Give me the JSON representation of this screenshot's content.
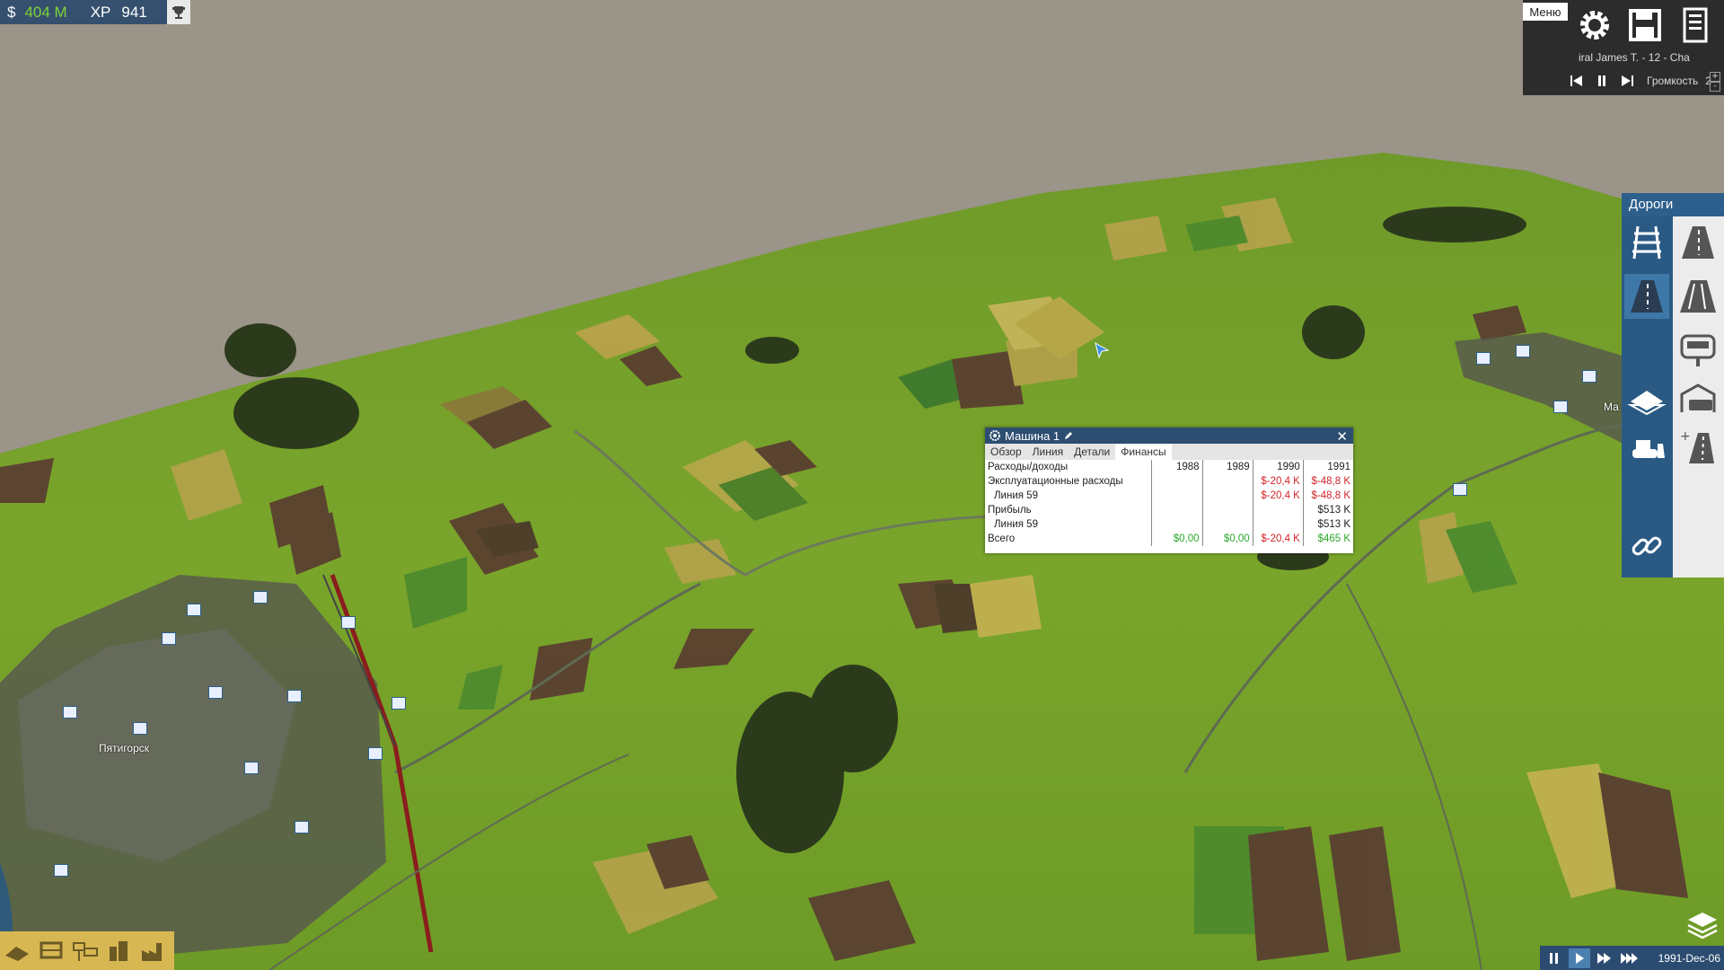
{
  "stats": {
    "currency_symbol": "$",
    "money": "404 M",
    "xp_label": "XP",
    "xp_value": "941",
    "trophy_icon": "trophy-icon"
  },
  "top_right": {
    "menu_label": "Меню",
    "settings_icon": "gear-icon",
    "save_icon": "floppy-disk-icon",
    "menu_icon": "menu-icon",
    "song": "iral James T. - 12 - Cha",
    "volume_label": "Громкость",
    "volume_value": "2",
    "vol_plus": "+",
    "vol_minus": "-"
  },
  "roads_panel": {
    "title": "Дороги"
  },
  "vehicle_window": {
    "title": "Машина 1",
    "close": "✕",
    "tabs": [
      "Обзор",
      "Линия",
      "Детали",
      "Финансы"
    ],
    "active_tab": "Финансы",
    "years": [
      "1988",
      "1989",
      "1990",
      "1991"
    ],
    "rows": [
      {
        "label": "Расходы/доходы",
        "indent": false,
        "values": [
          "",
          "",
          "",
          ""
        ]
      },
      {
        "label": "Эксплуатационные расходы",
        "indent": false,
        "values": [
          "",
          "",
          "$-20,4 K",
          "$-48,8 K"
        ]
      },
      {
        "label": "Линия 59",
        "indent": true,
        "values": [
          "",
          "",
          "$-20,4 K",
          "$-48,8 K"
        ]
      },
      {
        "label": "Прибыль",
        "indent": false,
        "values": [
          "",
          "",
          "",
          "$513 K"
        ]
      },
      {
        "label": "Линия 59",
        "indent": true,
        "values": [
          "",
          "",
          "",
          "$513 K"
        ]
      },
      {
        "label": "Всего",
        "indent": false,
        "values": [
          "$0,00",
          "$0,00",
          "$-20,4 K",
          "$465 K"
        ]
      }
    ],
    "colors": {
      "positive": "#2aa829",
      "negative": "#d2232a"
    }
  },
  "map": {
    "town_left": "Пятигорск",
    "town_right": "Ма"
  },
  "time": {
    "date": "1991-Dec-06"
  }
}
